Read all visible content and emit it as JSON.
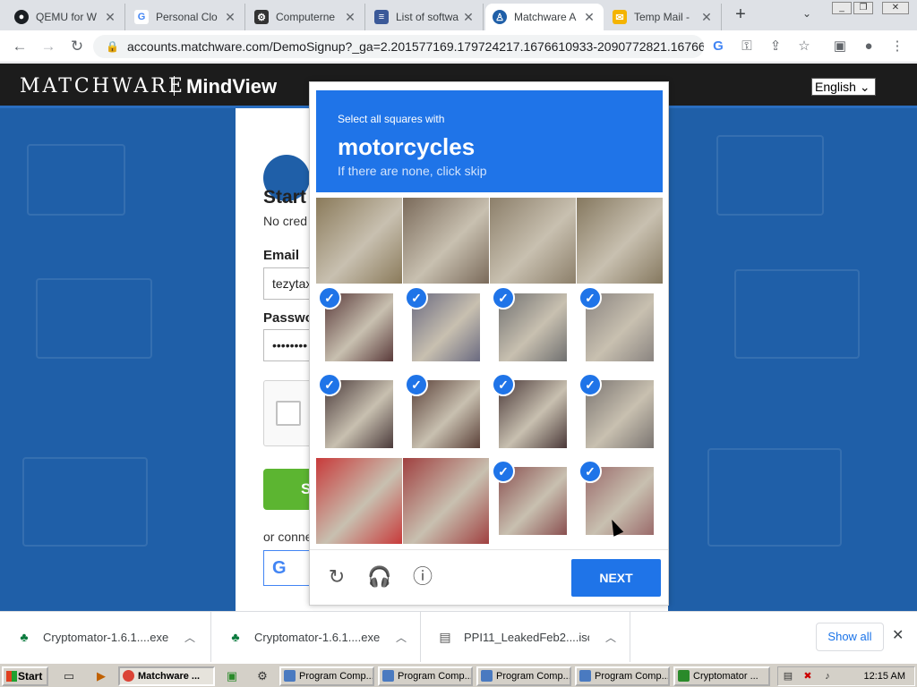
{
  "tabs": [
    {
      "label": "QEMU for W",
      "icon": "github-icon",
      "color": "#1b1f23"
    },
    {
      "label": "Personal Clo",
      "icon": "google-icon",
      "color": "#4285f4"
    },
    {
      "label": "Computerne",
      "icon": "computerneo-icon",
      "color": "#333333"
    },
    {
      "label": "List of softwa",
      "icon": "wiki-list-icon",
      "color": "#3b5998"
    },
    {
      "label": "Matchware A",
      "icon": "matchware-icon",
      "color": "#1f5fa8"
    },
    {
      "label": "Temp Mail -",
      "icon": "tempmail-icon",
      "color": "#f4b400"
    }
  ],
  "address": {
    "url": "accounts.matchware.com/DemoSignup?_ga=2.201577169.179724217.1676610933-2090772821.16766..."
  },
  "site": {
    "logo": "MATCHWARE",
    "product_logo": "MindView",
    "language": "English",
    "heading": "Start",
    "subtext": "No cred",
    "email_label": "Email",
    "email_value": "tezytax",
    "password_label": "Passwo",
    "password_value": "••••••••",
    "signup_label": "S",
    "or_connect": "or conne",
    "google_letter": "G"
  },
  "captcha": {
    "prompt": "Select all squares with",
    "object": "motorcycles",
    "hint": "If there are none, click skip",
    "next_label": "NEXT",
    "cells": [
      {
        "selected": false,
        "tone": "#8a7a5a"
      },
      {
        "selected": false,
        "tone": "#7a6a5a"
      },
      {
        "selected": false,
        "tone": "#8c7f6a"
      },
      {
        "selected": false,
        "tone": "#85785f"
      },
      {
        "selected": true,
        "tone": "#5a3a3a"
      },
      {
        "selected": true,
        "tone": "#6a6a80"
      },
      {
        "selected": true,
        "tone": "#707070"
      },
      {
        "selected": true,
        "tone": "#8a8480"
      },
      {
        "selected": true,
        "tone": "#4a3a3a"
      },
      {
        "selected": true,
        "tone": "#5a4038"
      },
      {
        "selected": true,
        "tone": "#4a3838"
      },
      {
        "selected": true,
        "tone": "#7a7470"
      },
      {
        "selected": false,
        "tone": "#c83a3a"
      },
      {
        "selected": false,
        "tone": "#a04040"
      },
      {
        "selected": true,
        "tone": "#8a5050"
      },
      {
        "selected": true,
        "tone": "#9a6a6a"
      }
    ]
  },
  "downloads": {
    "items": [
      {
        "name": "Cryptomator-1.6.1....exe"
      },
      {
        "name": "Cryptomator-1.6.1....exe"
      },
      {
        "name": "PPI11_LeakedFeb2....iso"
      }
    ],
    "show_all": "Show all"
  },
  "taskbar": {
    "start": "Start",
    "tasks": [
      {
        "label": "Matchware ..."
      },
      {
        "label": "Program Comp..."
      },
      {
        "label": "Program Comp..."
      },
      {
        "label": "Program Comp..."
      },
      {
        "label": "Program Comp..."
      },
      {
        "label": "Cryptomator ..."
      }
    ],
    "clock": "12:15 AM"
  }
}
